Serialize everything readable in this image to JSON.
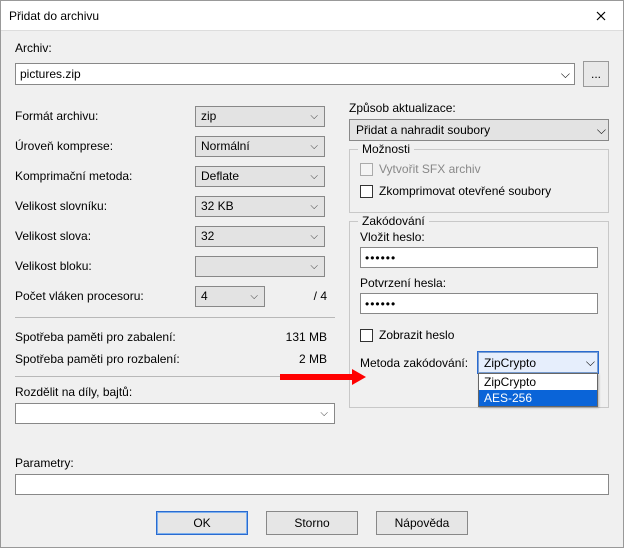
{
  "title": "Přidat do archivu",
  "archive_label": "Archiv:",
  "archive_value": "pictures.zip",
  "browse_label": "...",
  "left": {
    "format_label": "Formát archivu:",
    "format_value": "zip",
    "level_label": "Úroveň komprese:",
    "level_value": "Normální",
    "method_label": "Komprimační metoda:",
    "method_value": "Deflate",
    "dict_label": "Velikost slovníku:",
    "dict_value": "32 KB",
    "word_label": "Velikost slova:",
    "word_value": "32",
    "block_label": "Velikost bloku:",
    "block_value": "",
    "threads_label": "Počet vláken procesoru:",
    "threads_value": "4",
    "threads_max": "/ 4",
    "mem_pack_label": "Spotřeba paměti pro zabalení:",
    "mem_pack_value": "131 MB",
    "mem_unpack_label": "Spotřeba paměti pro rozbalení:",
    "mem_unpack_value": "2 MB",
    "split_label": "Rozdělit na díly, bajtů:",
    "params_label": "Parametry:"
  },
  "right": {
    "update_label": "Způsob aktualizace:",
    "update_value": "Přidat a nahradit soubory",
    "options_title": "Možnosti",
    "sfx_label": "Vytvořit SFX archiv",
    "compress_open_label": "Zkomprimovat otevřené soubory",
    "enc_title": "Zakódování",
    "pass_label": "Vložit heslo:",
    "pass_value": "••••••",
    "confirm_label": "Potvrzení hesla:",
    "confirm_value": "••••••",
    "show_pass_label": "Zobrazit heslo",
    "enc_method_label": "Metoda zakódování:",
    "enc_method_value": "ZipCrypto",
    "enc_opt1": "ZipCrypto",
    "enc_opt2": "AES-256"
  },
  "buttons": {
    "ok": "OK",
    "cancel": "Storno",
    "help": "Nápověda"
  }
}
